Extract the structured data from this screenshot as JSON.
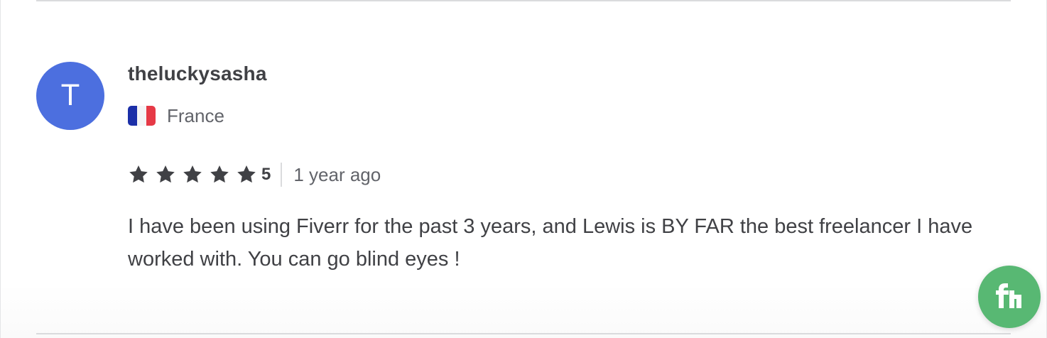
{
  "review": {
    "avatar_letter": "T",
    "username": "theluckysasha",
    "country": "France",
    "flag_icon": "france-flag-icon",
    "rating": "5",
    "star_count": 5,
    "time_ago": "1 year ago",
    "text": "I have been using Fiverr for the past 3 years, and Lewis is BY FAR the best freelancer I have worked with. You can go blind eyes !"
  },
  "chat_button": {
    "icon": "fiverr-logo-icon"
  },
  "colors": {
    "avatar_bg": "#4c6fdf",
    "star": "#404145",
    "fab_bg": "#58b873",
    "text_primary": "#404145",
    "text_secondary": "#62646a",
    "divider": "#dadbdd"
  }
}
